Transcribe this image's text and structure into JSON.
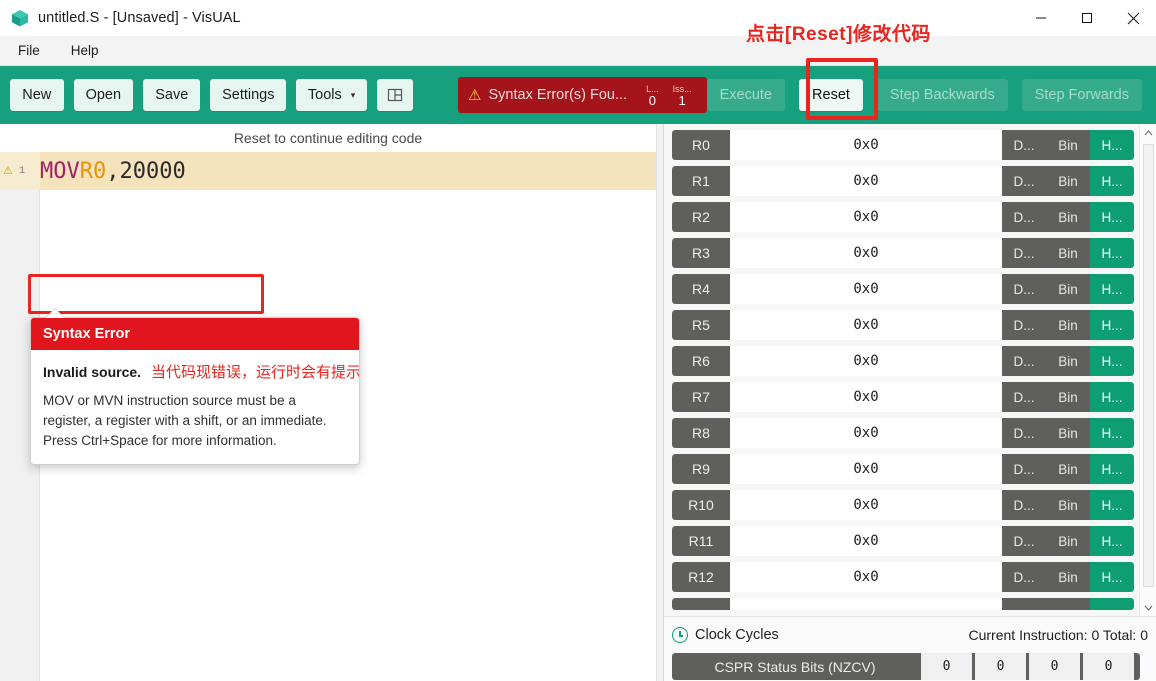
{
  "window": {
    "title": "untitled.S - [Unsaved] - VisUAL",
    "app_icon": "cube-icon",
    "controls": {
      "minimize": "minimize-icon",
      "maximize": "maximize-icon",
      "close": "close-icon"
    }
  },
  "menu": {
    "items": [
      {
        "label": "File"
      },
      {
        "label": "Help"
      }
    ]
  },
  "toolbar": {
    "new_label": "New",
    "open_label": "Open",
    "save_label": "Save",
    "settings_label": "Settings",
    "tools_label": "Tools",
    "tools_caret": "▾",
    "layout_icon": "layout-panel-icon",
    "error_badge": {
      "warn_icon": "⚠",
      "text": "Syntax Error(s) Fou...",
      "columns": [
        {
          "header": "L...",
          "value": "0"
        },
        {
          "header": "Iss...",
          "value": "1"
        }
      ]
    },
    "execute_label": "Execute",
    "reset_label": "Reset",
    "step_backwards_label": "Step Backwards",
    "step_forwards_label": "Step Forwards"
  },
  "editor": {
    "notice": "Reset to continue editing code",
    "line": {
      "number": "1",
      "warn_icon": "⚠",
      "mnemonic": "MOV",
      "space": " ",
      "register": "R0",
      "comma": ",",
      "immediate": "20000"
    }
  },
  "tooltip": {
    "title": "Syntax Error",
    "bold": "Invalid source.",
    "annotation_cn": "当代码现错误，运行时会有提示",
    "description": "MOV or MVN instruction source must be a register, a register with a shift, or an immediate. Press Ctrl+Space for more information."
  },
  "annotations": {
    "reset_hint_cn": "点击[Reset]修改代码"
  },
  "registers": {
    "buttons": {
      "dec": "D...",
      "bin": "Bin",
      "hex": "H...",
      "active": "hex"
    },
    "rows": [
      {
        "name": "R0",
        "value": "0x0"
      },
      {
        "name": "R1",
        "value": "0x0"
      },
      {
        "name": "R2",
        "value": "0x0"
      },
      {
        "name": "R3",
        "value": "0x0"
      },
      {
        "name": "R4",
        "value": "0x0"
      },
      {
        "name": "R5",
        "value": "0x0"
      },
      {
        "name": "R6",
        "value": "0x0"
      },
      {
        "name": "R7",
        "value": "0x0"
      },
      {
        "name": "R8",
        "value": "0x0"
      },
      {
        "name": "R9",
        "value": "0x0"
      },
      {
        "name": "R10",
        "value": "0x0"
      },
      {
        "name": "R11",
        "value": "0x0"
      },
      {
        "name": "R12",
        "value": "0x0"
      }
    ],
    "scrollbar": {
      "up": "∧",
      "down": "∨"
    }
  },
  "status": {
    "clock_icon": "clock-icon",
    "clock_label": "Clock Cycles",
    "current_instruction_text": "Current Instruction: 0  Total: 0",
    "cspr_label": "CSPR Status Bits (NZCV)",
    "cspr_bits": [
      "0",
      "0",
      "0",
      "0"
    ]
  },
  "colors": {
    "toolbar_green": "#17a07e",
    "error_red": "#a5141b",
    "annotation_red": "#e8251f",
    "register_gray": "#5f5f5c",
    "hex_active": "#0d9e74",
    "error_line_bg": "#f5e3bb"
  }
}
